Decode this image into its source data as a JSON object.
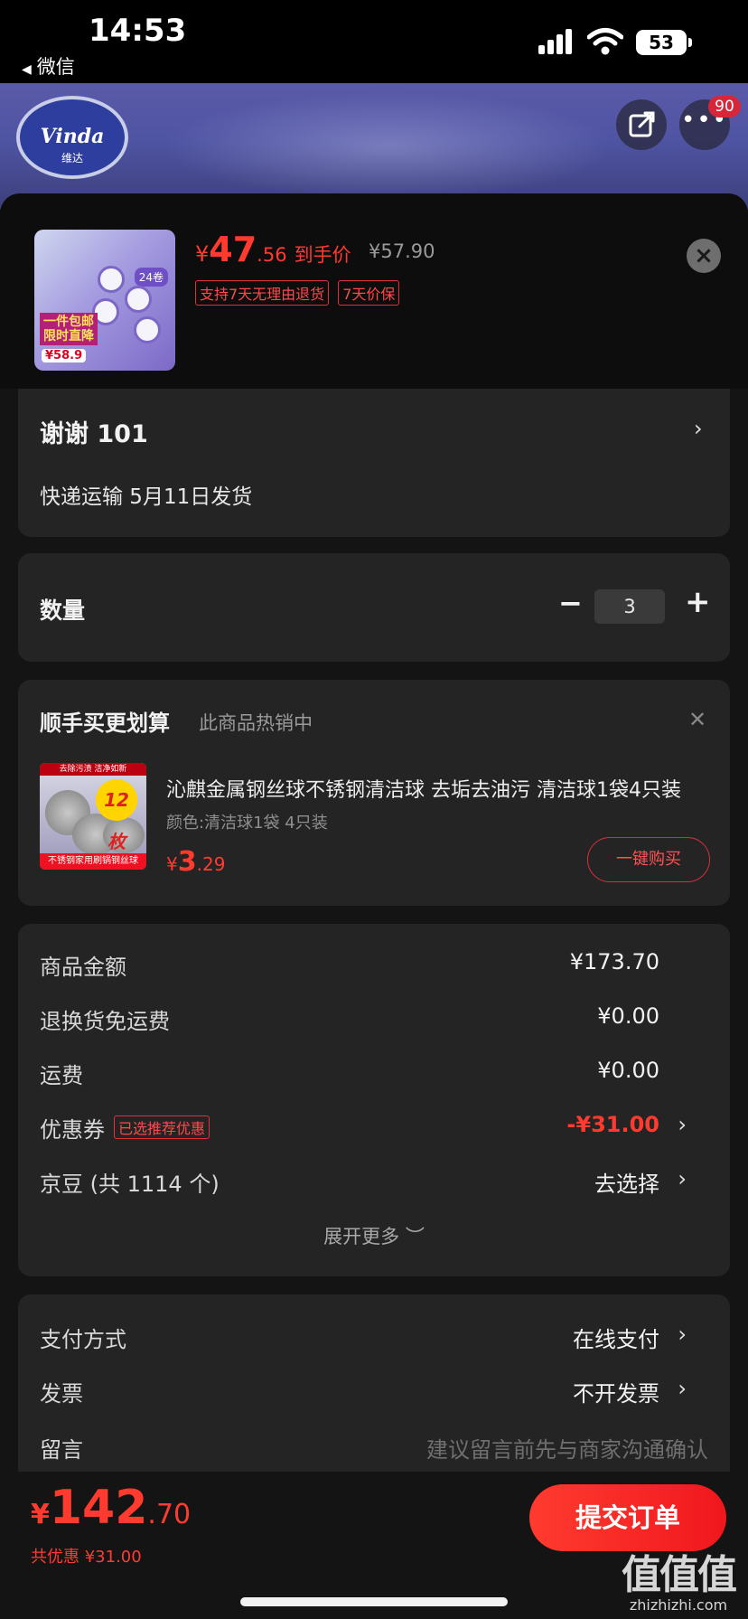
{
  "status_bar": {
    "time": "14:53",
    "back_app": "微信",
    "battery": "53"
  },
  "header": {
    "brand_logo": "Vinda",
    "brand_logo_sub": "维达",
    "badge_count": "90",
    "icons": [
      "share-icon",
      "more-icon"
    ]
  },
  "product": {
    "price_yen": "¥",
    "price_int": "47",
    "price_dec": ".56",
    "price_label": "到手价",
    "original_price": "¥57.90",
    "tags": [
      "支持7天无理由退货",
      "7天价保"
    ],
    "thumb_badge": "24卷",
    "thumb_promo": "一件包邮 限时直降",
    "thumb_price": "¥58.9"
  },
  "address": {
    "name": "谢谢  101",
    "shipping": "快递运输 5月11日发货"
  },
  "quantity": {
    "label": "数量",
    "value": "3"
  },
  "addon": {
    "title": "顺手买更划算",
    "subtitle": "此商品热销中",
    "item_name": "沁麒金属钢丝球不锈钢清洁球 去垢去油污 清洁球1袋4只装",
    "item_spec": "颜色:清洁球1袋 4只装",
    "price_yen": "¥",
    "price_int": "3",
    "price_dec": ".29",
    "buy_label": "一键购买",
    "thumb_top": "去除污渍 洁净如新",
    "thumb_count": "12枚",
    "thumb_foot": "不锈钢家用刷锅钢丝球"
  },
  "summary": {
    "rows": [
      {
        "label": "商品金额",
        "value": "¥173.70"
      },
      {
        "label": "退换货免运费",
        "value": "¥0.00"
      },
      {
        "label": "运费",
        "value": "¥0.00"
      },
      {
        "label": "优惠券",
        "tag": "已选推荐优惠",
        "value": "-¥31.00"
      },
      {
        "label": "京豆 (共 1114 个)",
        "value": "去选择"
      }
    ],
    "expand": "展开更多 ︶"
  },
  "payment": {
    "rows": [
      {
        "label": "支付方式",
        "value": "在线支付"
      },
      {
        "label": "发票",
        "value": "不开发票"
      },
      {
        "label": "留言",
        "value": "建议留言前先与商家沟通确认"
      }
    ]
  },
  "footer": {
    "total_yen": "¥",
    "total_int": "142",
    "total_dec": ".70",
    "saving": "共优惠 ¥31.00",
    "submit": "提交订单",
    "watermark": "值值值",
    "watermark_url": "zhizhizhi.com"
  },
  "colors": {
    "accent": "#ff3b30",
    "card_bg": "#242424",
    "page_bg": "#141414"
  }
}
